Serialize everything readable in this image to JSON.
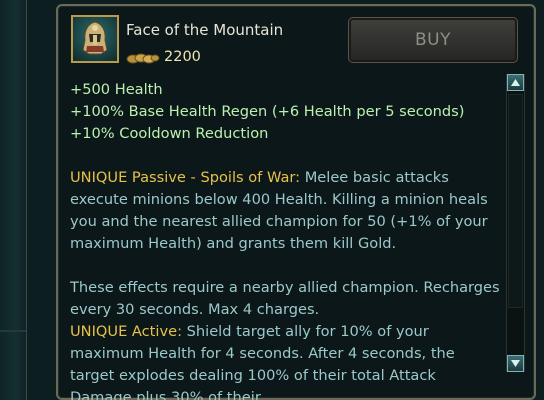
{
  "item": {
    "name": "Face of the Mountain",
    "price": "2200",
    "icon": "helmet-icon",
    "coin_icon": "gold-coins-icon"
  },
  "buy_button": {
    "label": "BUY"
  },
  "stats": [
    "+500 Health",
    "+100% Base Health Regen (+6 Health per 5 seconds)",
    "+10% Cooldown Reduction"
  ],
  "passive": {
    "title": "UNIQUE Passive - Spoils of War:",
    "text": "Melee basic attacks execute minions below 400 Health. Killing a minion heals you and the nearest allied champion for 50 (+1% of your maximum Health) and grants them kill Gold."
  },
  "effects_note": "These effects require a nearby allied champion. Recharges every 30 seconds. Max 4 charges.",
  "active": {
    "title": "UNIQUE Active:",
    "text": "Shield target ally for 10% of your maximum Health for 4 seconds. After 4 seconds, the target explodes dealing 100% of their total Attack Damage plus 30% of their"
  },
  "scrollbar": {
    "up_icon": "arrow-up-icon",
    "down_icon": "arrow-down-icon"
  },
  "colors": {
    "stat": "#b9f2b0",
    "unique": "#e6c24a",
    "body": "#9bc9cb",
    "border_gold": "#b99a4a"
  }
}
